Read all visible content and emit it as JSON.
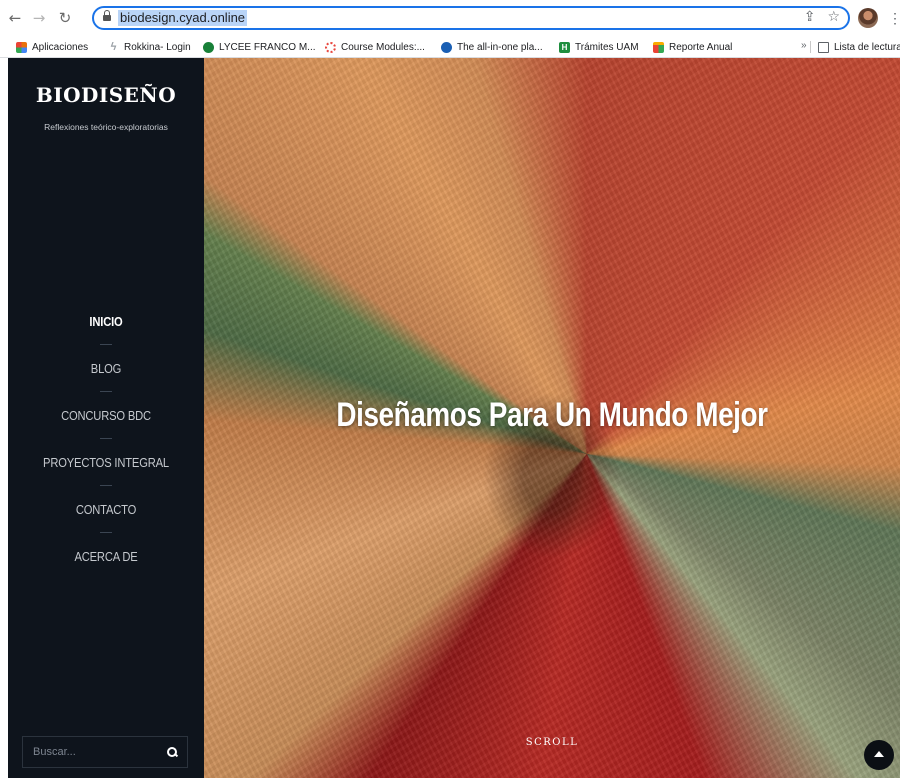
{
  "browser": {
    "url": "biodesign.cyad.online",
    "bookmarks": [
      {
        "label": "Aplicaciones",
        "icon": "apps-grid-icon",
        "color": "#e8710a"
      },
      {
        "label": "Rokkina- Login",
        "icon": "rokkina-icon",
        "color": "#9aa0a6"
      },
      {
        "label": "LYCEE FRANCO M...",
        "icon": "lycee-icon",
        "color": "#188038"
      },
      {
        "label": "Course Modules:...",
        "icon": "course-icon",
        "color": "#e8453c"
      },
      {
        "label": "The all-in-one pla...",
        "icon": "platform-icon",
        "color": "#1a5fb4"
      },
      {
        "label": "Trámites UAM",
        "icon": "uam-icon",
        "color": "#1e8e3e"
      },
      {
        "label": "Reporte Anual",
        "icon": "report-icon",
        "color": "#f9ab00"
      }
    ],
    "more_bookmarks": "»",
    "reading_list": "Lista de lectura"
  },
  "site": {
    "brand": "BIODISEÑO",
    "tagline": "Reflexiones teórico-exploratorias",
    "nav": [
      {
        "label": "INICIO",
        "active": true
      },
      {
        "label": "BLOG",
        "active": false
      },
      {
        "label": "CONCURSO BDC",
        "active": false
      },
      {
        "label": "PROYECTOS INTEGRAL",
        "active": false
      },
      {
        "label": "CONTACTO",
        "active": false
      },
      {
        "label": "ACERCA DE",
        "active": false
      }
    ],
    "search_placeholder": "Buscar...",
    "hero_title": "Diseñamos Para Un Mundo Mejor",
    "scroll_label": "SCROLL"
  }
}
